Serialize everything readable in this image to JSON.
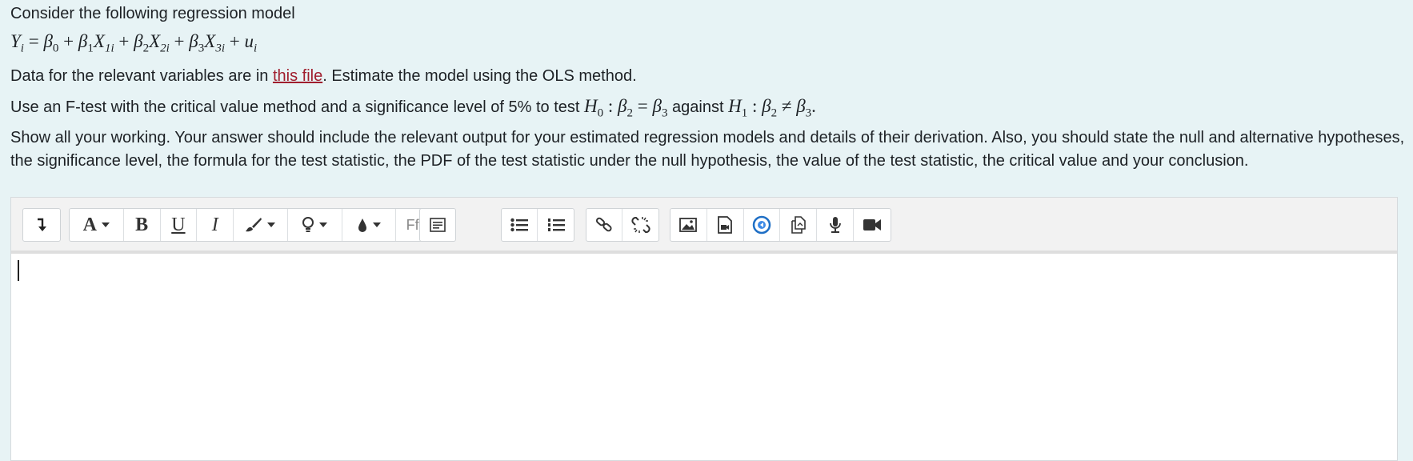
{
  "question": {
    "intro": "Consider the following regression model",
    "data_prefix": "Data for the relevant variables are in ",
    "data_link": "this file",
    "data_suffix": ". Estimate the model using the OLS method.",
    "ftest_prefix": "Use an F-test with the critical value method and a significance level of 5% to test ",
    "ftest_against": " against ",
    "instructions": "Show all your working. Your answer should include the relevant output for your estimated regression models and details of their derivation. Also, you should state the null and alternative hypotheses, the significance level, the formula for the test statistic, the PDF of the test statistic under the null hypothesis, the value of the test statistic, the critical value and your conclusion."
  },
  "math": {
    "Y": "Y",
    "i": "i",
    "eq": "=",
    "plus": "+",
    "beta": "β",
    "d0": "0",
    "d1": "1",
    "d2": "2",
    "d3": "3",
    "X": "X",
    "u": "u",
    "H": "H",
    "colon": ":",
    "ne": "≠",
    "dot": ".",
    "s1i": "1i",
    "s2i": "2i",
    "s3i": "3i"
  },
  "toolbar": {
    "icons": [
      "collapse-icon",
      "font-size-icon",
      "bold-icon",
      "underline-icon",
      "italic-icon",
      "paint-brush-icon",
      "lightbulb-icon",
      "color-drop-icon",
      "font-family-icon",
      "paragraph-icon",
      "unordered-list-icon",
      "ordered-list-icon",
      "link-icon",
      "unlink-icon",
      "image-icon",
      "media-icon",
      "recordrtc-icon",
      "copy-icon",
      "microphone-icon",
      "video-camera-icon"
    ],
    "bold": "B",
    "underline": "U",
    "italic": "I",
    "fontsize": "A",
    "fontfamily": "Ff"
  }
}
